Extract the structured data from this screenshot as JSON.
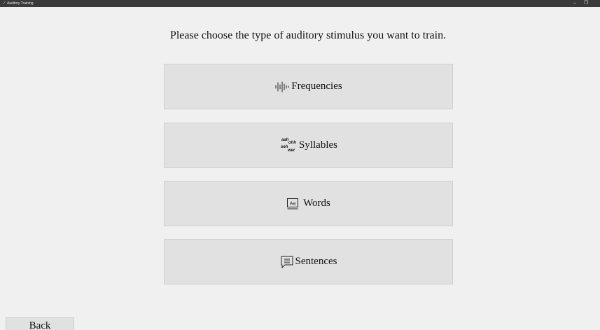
{
  "window": {
    "title": "Auditory Training",
    "minimize_glyph": "–",
    "restore_glyph": "❐"
  },
  "prompt": "Please choose the type of auditory stimulus you want to train.",
  "options": [
    {
      "label": "Frequencies",
      "icon": "waveform-icon"
    },
    {
      "label": "Syllables",
      "icon": "syllables-icon",
      "icon_text": [
        "aah",
        "ohh",
        "seh",
        "wer"
      ]
    },
    {
      "label": "Words",
      "icon": "dictionary-icon",
      "icon_text": "Aa"
    },
    {
      "label": "Sentences",
      "icon": "message-lines-icon"
    }
  ],
  "back_label": "Back"
}
